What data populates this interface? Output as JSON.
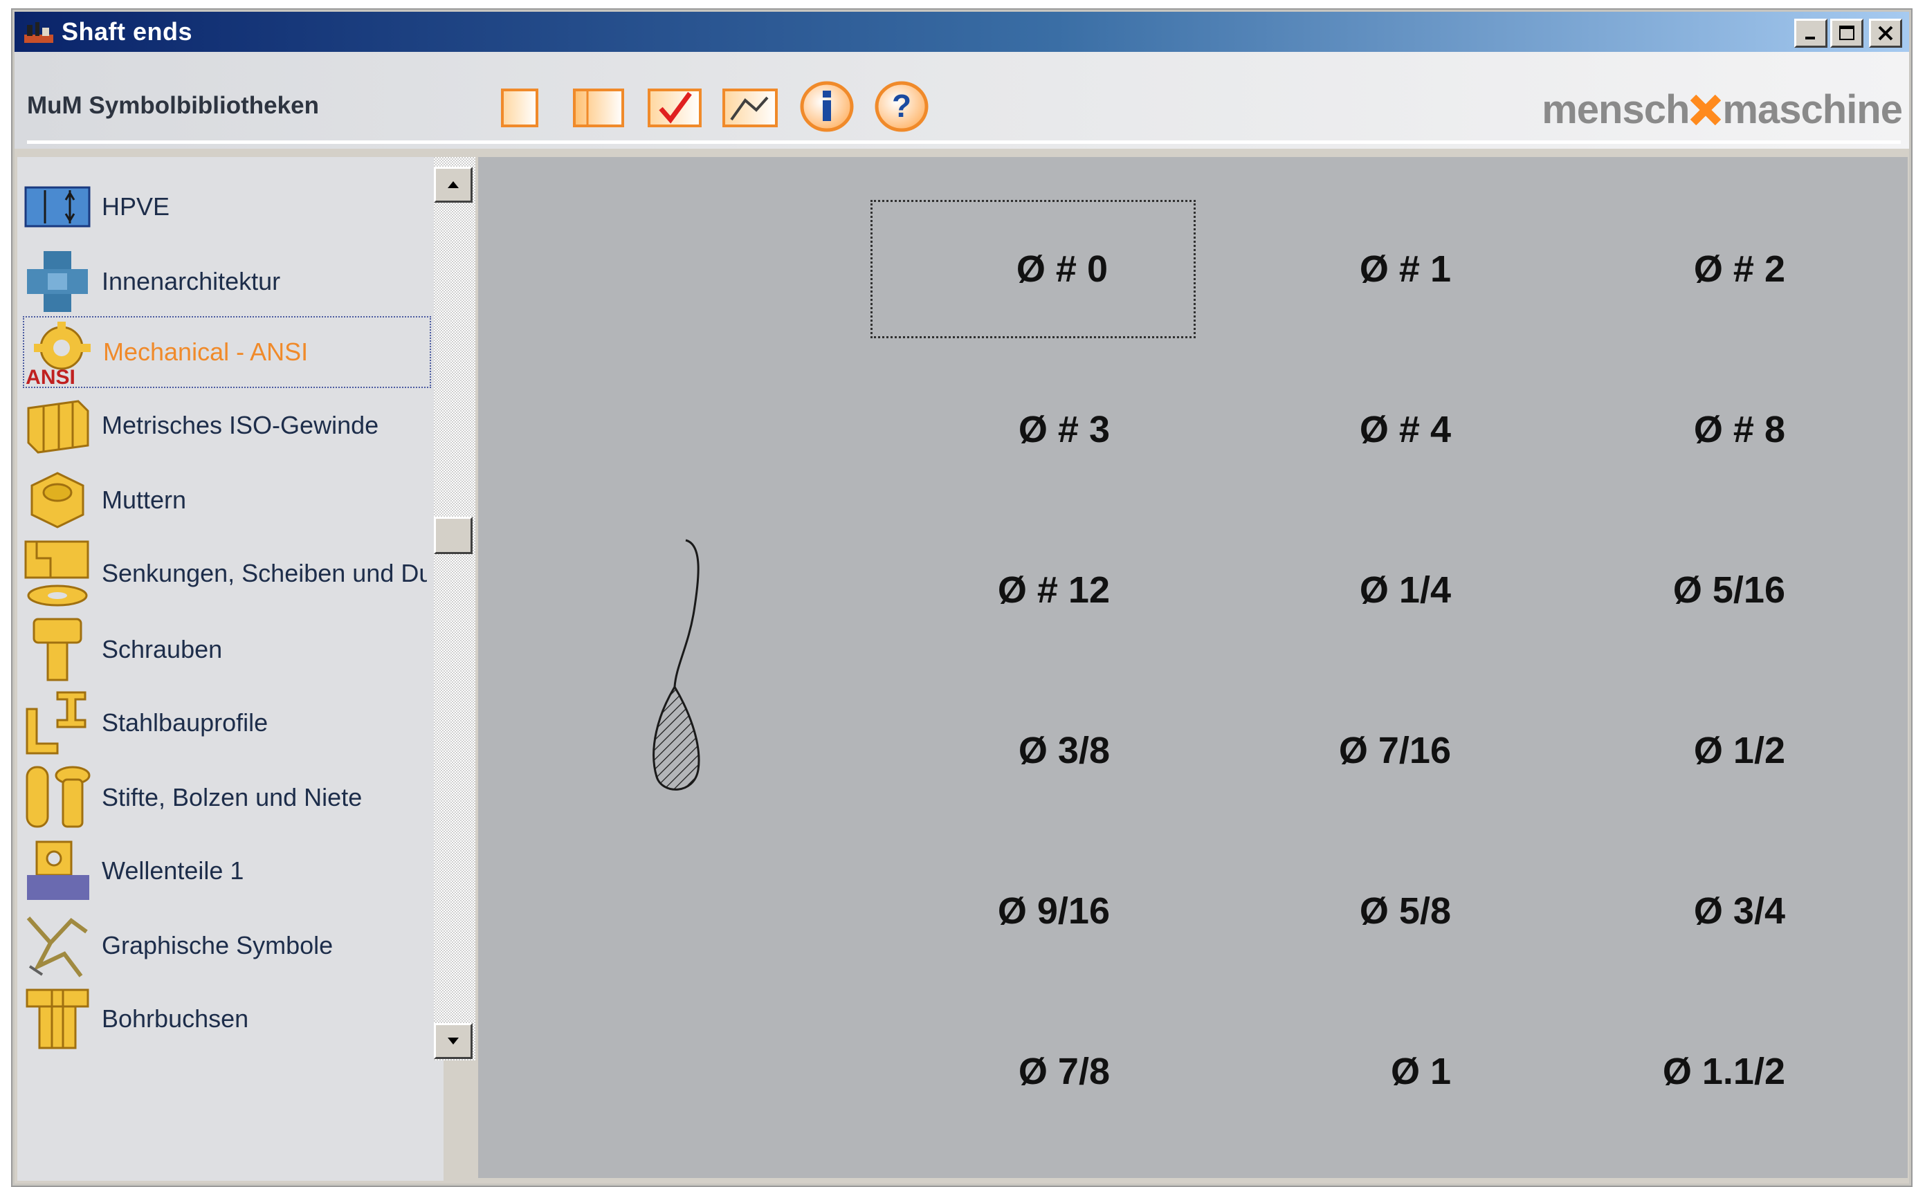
{
  "window": {
    "title": "Shaft ends",
    "controls": [
      "minimize",
      "maximize",
      "close"
    ]
  },
  "header": {
    "label": "MuM Symbolbibliotheken",
    "logo_left": "mensch",
    "logo_right": "maschine",
    "tools": [
      {
        "icon": "new-page-icon"
      },
      {
        "icon": "panel-icon"
      },
      {
        "icon": "check-icon"
      },
      {
        "icon": "export-icon"
      },
      {
        "icon": "info-icon",
        "glyph": "i"
      },
      {
        "icon": "help-icon",
        "glyph": "?"
      }
    ]
  },
  "libraries": [
    {
      "label": "HPVE",
      "icon": "hpve-icon",
      "selected": false
    },
    {
      "label": "Innenarchitektur",
      "icon": "interior-icon",
      "selected": false
    },
    {
      "label": "Mechanical - ANSI",
      "icon": "gear-ansi-icon",
      "badge": "ANSI",
      "selected": true
    },
    {
      "label": "Metrisches ISO-Gewinde",
      "icon": "thread-icon",
      "selected": false
    },
    {
      "label": "Muttern",
      "icon": "nut-icon",
      "selected": false
    },
    {
      "label": "Senkungen, Scheiben und Du",
      "icon": "washer-icon",
      "selected": false
    },
    {
      "label": "Schrauben",
      "icon": "screw-icon",
      "selected": false
    },
    {
      "label": "Stahlbauprofile",
      "icon": "steel-profile-icon",
      "selected": false
    },
    {
      "label": "Stifte, Bolzen und Niete",
      "icon": "pin-icon",
      "selected": false
    },
    {
      "label": "Wellenteile 1",
      "icon": "shaft-part-icon",
      "selected": false
    },
    {
      "label": "Graphische Symbole",
      "icon": "graphic-symbol-icon",
      "selected": false
    },
    {
      "label": "Bohrbuchsen",
      "icon": "bushing-icon",
      "selected": false
    }
  ],
  "symbols": [
    [
      "Ø # 0",
      "Ø # 1",
      "Ø # 2"
    ],
    [
      "Ø # 3",
      "Ø # 4",
      "Ø # 8"
    ],
    [
      "Ø # 12",
      "Ø 1/4",
      "Ø 5/16"
    ],
    [
      "Ø 3/8",
      "Ø 7/16",
      "Ø 1/2"
    ],
    [
      "Ø 9/16",
      "Ø 5/8",
      "Ø 3/4"
    ],
    [
      "Ø 7/8",
      "Ø 1",
      "Ø 1.1/2"
    ]
  ],
  "selected_symbol": "Ø # 0",
  "colors": {
    "accent": "#f08a2a",
    "title_bar": "#0a246a",
    "canvas": "#b3b5b8"
  }
}
